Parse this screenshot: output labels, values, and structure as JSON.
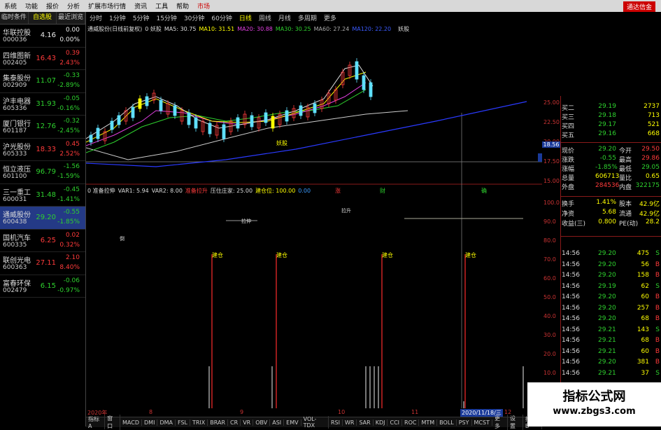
{
  "menu": {
    "items": [
      "系统",
      "功能",
      "报价",
      "分析",
      "扩展市场行情",
      "资讯",
      "工具",
      "帮助",
      "市场"
    ],
    "right_button": "通达信金"
  },
  "left_tabs": [
    "临时条件",
    "自选股",
    "最近浏览"
  ],
  "stocks": [
    {
      "name": "华联控股",
      "code": "000036",
      "price": "4.16",
      "chg": "0.00",
      "pct": "0.00%",
      "dir": "wh"
    },
    {
      "name": "四维图新",
      "code": "002405",
      "price": "16.43",
      "chg": "0.39",
      "pct": "2.43%",
      "dir": "up"
    },
    {
      "name": "集泰股份",
      "code": "002909",
      "price": "11.07",
      "chg": "-0.33",
      "pct": "-2.89%",
      "dir": "dn"
    },
    {
      "name": "沪丰电器",
      "code": "605336",
      "price": "31.93",
      "chg": "-0.05",
      "pct": "-0.16%",
      "dir": "dn"
    },
    {
      "name": "厦门银行",
      "code": "601187",
      "price": "12.76",
      "chg": "-0.32",
      "pct": "-2.45%",
      "dir": "dn"
    },
    {
      "name": "沪光股份",
      "code": "605333",
      "price": "18.33",
      "chg": "0.45",
      "pct": "2.52%",
      "dir": "up"
    },
    {
      "name": "恒立液压",
      "code": "601100",
      "price": "96.79",
      "chg": "-1.56",
      "pct": "-1.59%",
      "dir": "dn"
    },
    {
      "name": "三一重工",
      "code": "600031",
      "price": "31.48",
      "chg": "-0.45",
      "pct": "-1.41%",
      "dir": "dn"
    },
    {
      "name": "通威股份",
      "code": "600438",
      "price": "29.20",
      "chg": "-0.55",
      "pct": "-1.85%",
      "dir": "dn",
      "selected": true
    },
    {
      "name": "国机汽车",
      "code": "600335",
      "price": "6.25",
      "chg": "0.02",
      "pct": "0.32%",
      "dir": "up"
    },
    {
      "name": "联创光电",
      "code": "600363",
      "price": "27.11",
      "chg": "2.10",
      "pct": "8.40%",
      "dir": "up"
    },
    {
      "name": "富春环保",
      "code": "002479",
      "price": "6.15",
      "chg": "-0.06",
      "pct": "-0.97%",
      "dir": "dn"
    }
  ],
  "chart_tabs": [
    "分时",
    "1分钟",
    "5分钟",
    "15分钟",
    "30分钟",
    "60分钟",
    "日线",
    "周线",
    "月线",
    "多周期",
    "更多"
  ],
  "chart_active_tab": "日线",
  "main_indicator": {
    "title": "通威股份(日线前复权)",
    "items": [
      {
        "text": "0 妖股",
        "color": "#ddd"
      },
      {
        "text": "MA5: 30.75",
        "color": "#ddd"
      },
      {
        "text": "MA10: 31.51",
        "color": "#ff0"
      },
      {
        "text": "MA20: 30.88",
        "color": "#e040e0"
      },
      {
        "text": "MA30: 30.25",
        "color": "#2ed12e"
      },
      {
        "text": "MA60: 27.24",
        "color": "#aaa"
      },
      {
        "text": "MA120: 22.20",
        "color": "#3b5bff"
      }
    ],
    "right_label": "妖股"
  },
  "sub_indicator": {
    "items": [
      {
        "text": "0 准备拉伸",
        "color": "#ddd"
      },
      {
        "text": "VAR1: 5.94",
        "color": "#ddd"
      },
      {
        "text": "VAR2: 8.00",
        "color": "#ddd"
      },
      {
        "text": "准备拉升",
        "color": "#ff3b3b"
      },
      {
        "text": "压住庄家: 25.00",
        "color": "#ddd"
      },
      {
        "text": "建仓位: 100.00",
        "color": "#ff0"
      },
      {
        "text": "0.00",
        "color": "#3b9bff"
      }
    ]
  },
  "signal_labels": [
    "建仓",
    "建仓",
    "建仓",
    "建仓"
  ],
  "small_labels": {
    "yao": "妖股",
    "dao": "倒",
    "zhang": "涨",
    "cai": "财",
    "quan": "确",
    "zhen": "拉伸",
    "shi": "拉升"
  },
  "crosshair_price": "18.56",
  "price_scale": [
    "25.00",
    "22.50",
    "20.00",
    "17.50",
    "15.00"
  ],
  "sub_scale": [
    "100.0",
    "90.0",
    "80.0",
    "70.0",
    "60.0",
    "50.0",
    "40.0",
    "30.0",
    "20.0",
    "10.0"
  ],
  "dates": {
    "d1": "2020年",
    "d2": "8",
    "d3": "9",
    "d4": "10",
    "d5": "11",
    "cursor_date": "2020/11/18/三",
    "d6": "12"
  },
  "bottom_tabs": [
    "指标A",
    "窗口",
    "MACD",
    "DMI",
    "DMA",
    "FSL",
    "TRIX",
    "BRAR",
    "CR",
    "VR",
    "OBV",
    "ASI",
    "EMV",
    "VOL-TDX",
    "RSI",
    "WR",
    "SAR",
    "KDJ",
    "CCI",
    "ROC",
    "MTM",
    "BOLL",
    "PSY",
    "MCST",
    "更多",
    "设置",
    "指标B"
  ],
  "quotes": [
    {
      "label": "买二",
      "price": "29.19",
      "vol": "2737"
    },
    {
      "label": "买三",
      "price": "29.18",
      "vol": "713"
    },
    {
      "label": "买四",
      "price": "29.17",
      "vol": "521"
    },
    {
      "label": "买五",
      "price": "29.16",
      "vol": "668"
    }
  ],
  "stats": [
    {
      "l1": "现价",
      "v1": "29.20",
      "l2": "今开",
      "v2": "29.50",
      "c1": "#2ed12e",
      "c2": "#ff3b3b"
    },
    {
      "l1": "涨跌",
      "v1": "-0.55",
      "l2": "最高",
      "v2": "29.86",
      "c1": "#2ed12e",
      "c2": "#ff3b3b"
    },
    {
      "l1": "涨幅",
      "v1": "-1.85%",
      "l2": "最低",
      "v2": "29.05",
      "c1": "#2ed12e",
      "c2": "#2ed12e"
    },
    {
      "l1": "总量",
      "v1": "606713",
      "l2": "量比",
      "v2": "0.65",
      "c1": "#ff0",
      "c2": "#ff0"
    },
    {
      "l1": "外盘",
      "v1": "284536",
      "l2": "内盘",
      "v2": "322175",
      "c1": "#ff3b3b",
      "c2": "#2ed12e"
    },
    {
      "l1": "换手",
      "v1": "1.41%",
      "l2": "股本",
      "v2": "42.9亿",
      "c1": "#ff0",
      "c2": "#ff0"
    },
    {
      "l1": "净资",
      "v1": "5.68",
      "l2": "流通",
      "v2": "42.9亿",
      "c1": "#ff0",
      "c2": "#ff0"
    },
    {
      "l1": "收益(三)",
      "v1": "0.800",
      "l2": "PE(动)",
      "v2": "28.2",
      "c1": "#ff0",
      "c2": "#ff0"
    }
  ],
  "ticks": [
    {
      "t": "14:56",
      "p": "29.20",
      "v": "475",
      "s": "S",
      "pc": "#2ed12e",
      "sc": "#2ed12e"
    },
    {
      "t": "14:56",
      "p": "29.20",
      "v": "56",
      "s": "B",
      "pc": "#2ed12e",
      "sc": "#ff3b3b"
    },
    {
      "t": "14:56",
      "p": "29.20",
      "v": "158",
      "s": "B",
      "pc": "#2ed12e",
      "sc": "#ff3b3b"
    },
    {
      "t": "14:56",
      "p": "29.19",
      "v": "62",
      "s": "S",
      "pc": "#2ed12e",
      "sc": "#2ed12e"
    },
    {
      "t": "14:56",
      "p": "29.20",
      "v": "60",
      "s": "B",
      "pc": "#2ed12e",
      "sc": "#ff3b3b"
    },
    {
      "t": "14:56",
      "p": "29.20",
      "v": "257",
      "s": "B",
      "pc": "#2ed12e",
      "sc": "#ff3b3b"
    },
    {
      "t": "14:56",
      "p": "29.20",
      "v": "68",
      "s": "B",
      "pc": "#2ed12e",
      "sc": "#ff3b3b"
    },
    {
      "t": "14:56",
      "p": "29.21",
      "v": "143",
      "s": "S",
      "pc": "#2ed12e",
      "sc": "#2ed12e"
    },
    {
      "t": "14:56",
      "p": "29.21",
      "v": "68",
      "s": "B",
      "pc": "#2ed12e",
      "sc": "#ff3b3b"
    },
    {
      "t": "14:56",
      "p": "29.21",
      "v": "60",
      "s": "B",
      "pc": "#2ed12e",
      "sc": "#ff3b3b"
    },
    {
      "t": "14:56",
      "p": "29.20",
      "v": "381",
      "s": "B",
      "pc": "#2ed12e",
      "sc": "#ff3b3b"
    },
    {
      "t": "14:56",
      "p": "29.21",
      "v": "37",
      "s": "S",
      "pc": "#2ed12e",
      "sc": "#2ed12e"
    }
  ],
  "watermark": {
    "line1": "指标公式网",
    "line2": "www.zbgs3.com"
  }
}
